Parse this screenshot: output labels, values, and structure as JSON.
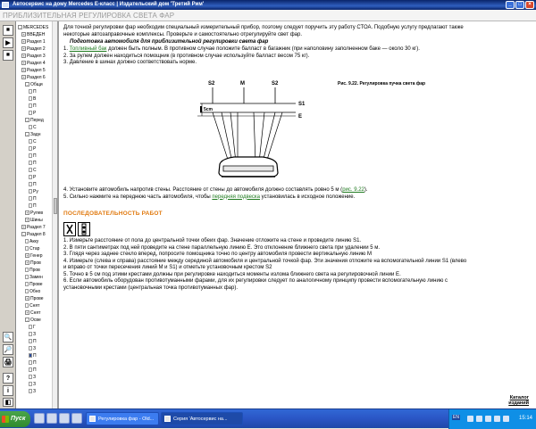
{
  "window": {
    "title": "Автосервис на дому Mercedes E-класс | Издательский дом 'Третий Рим'"
  },
  "page": {
    "header": "ПРИБЛИЗИТЕЛЬНАЯ РЕГУЛИРОВКА СВЕТА ФАР"
  },
  "toolbar": {
    "buttons": [
      "⏹",
      "▶",
      "⏹",
      "🔍",
      "🔎",
      "🖨",
      "?",
      "i",
      "◧"
    ]
  },
  "tree": {
    "items": [
      {
        "label": "MERCEDES",
        "box": "-",
        "indent": 0
      },
      {
        "label": "ВВЕДЕН",
        "box": "+",
        "indent": 1
      },
      {
        "label": "Раздел 1",
        "box": "+",
        "indent": 1
      },
      {
        "label": "Раздел 2",
        "box": "+",
        "indent": 1
      },
      {
        "label": "Раздел 3",
        "box": "+",
        "indent": 1
      },
      {
        "label": "Раздел 4",
        "box": "+",
        "indent": 1
      },
      {
        "label": "Раздел 5",
        "box": "+",
        "indent": 1
      },
      {
        "label": "Раздел 6",
        "box": "+",
        "indent": 1
      },
      {
        "label": "Общи",
        "box": "-",
        "indent": 2
      },
      {
        "label": "П",
        "page": true,
        "indent": 3
      },
      {
        "label": "В",
        "page": true,
        "indent": 3
      },
      {
        "label": "П",
        "page": true,
        "indent": 3
      },
      {
        "label": "Р",
        "page": true,
        "indent": 3
      },
      {
        "label": "Перед",
        "box": "-",
        "indent": 2
      },
      {
        "label": "С",
        "page": true,
        "indent": 3
      },
      {
        "label": "Задн",
        "box": "-",
        "indent": 2
      },
      {
        "label": "С",
        "page": true,
        "indent": 3
      },
      {
        "label": "Р",
        "page": true,
        "indent": 3
      },
      {
        "label": "П",
        "page": true,
        "indent": 3
      },
      {
        "label": "П",
        "page": true,
        "indent": 3
      },
      {
        "label": "С",
        "page": true,
        "indent": 3
      },
      {
        "label": "Р",
        "page": true,
        "indent": 3
      },
      {
        "label": "П",
        "page": true,
        "indent": 3
      },
      {
        "label": "Ру",
        "page": true,
        "indent": 3
      },
      {
        "label": "П",
        "page": true,
        "indent": 3
      },
      {
        "label": "П",
        "page": true,
        "indent": 3
      },
      {
        "label": "Рулев",
        "box": "+",
        "indent": 2
      },
      {
        "label": "Шины",
        "box": "+",
        "indent": 2
      },
      {
        "label": "Раздел 7",
        "box": "+",
        "indent": 1
      },
      {
        "label": "Раздел 8",
        "box": "-",
        "indent": 1
      },
      {
        "label": "Акку",
        "page": true,
        "indent": 2
      },
      {
        "label": "Стар",
        "page": true,
        "indent": 2
      },
      {
        "label": "Генер",
        "box": "+",
        "indent": 2
      },
      {
        "label": "Пров",
        "box": "+",
        "indent": 2
      },
      {
        "label": "Пров",
        "page": true,
        "indent": 2
      },
      {
        "label": "Замен",
        "page": true,
        "indent": 2
      },
      {
        "label": "Прове",
        "page": true,
        "indent": 2
      },
      {
        "label": "Обно",
        "page": true,
        "indent": 2
      },
      {
        "label": "Прове",
        "box": "+",
        "indent": 2
      },
      {
        "label": "Снят",
        "page": true,
        "indent": 2
      },
      {
        "label": "Снят",
        "box": "+",
        "indent": 2
      },
      {
        "label": "Осве",
        "box": "-",
        "indent": 2
      },
      {
        "label": "Г",
        "page": true,
        "indent": 3
      },
      {
        "label": "З",
        "page": true,
        "indent": 3
      },
      {
        "label": "П",
        "page": true,
        "indent": 3
      },
      {
        "label": "З",
        "page": true,
        "indent": 3
      },
      {
        "label": "П",
        "page": true,
        "indent": 3,
        "active": true
      },
      {
        "label": "П",
        "page": true,
        "indent": 3
      },
      {
        "label": "П",
        "page": true,
        "indent": 3
      },
      {
        "label": "З",
        "page": true,
        "indent": 3
      },
      {
        "label": "З",
        "page": true,
        "indent": 3
      },
      {
        "label": "З",
        "page": true,
        "indent": 3
      }
    ]
  },
  "content": {
    "intro": [
      "Для точной регулировки фар необходим специальный измерительный прибор, поэтому следует поручить эту работу СТОА. Подобную услугу предлагают также",
      "некоторые автозаправочные комплексы. Проверьте и самостоятельно отрегулируйте свет фар."
    ],
    "prep_title": "Подготовка автомобиля для приблизительной регулировки света фар",
    "prep_steps": [
      {
        "num": "1.",
        "link": "Топливный бак",
        "text": " должен быть полным. В противном случае положите балласт в багажник (при наполовину заполненном баке — около 30 кг)."
      },
      {
        "num": "2.",
        "link": "",
        "text": "За рулем должен находиться помощник (в противном случае используйте балласт весом 75 кг)."
      },
      {
        "num": "3.",
        "link": "",
        "text": "Давление в шинах должно соответствовать норме."
      }
    ],
    "figure": {
      "caption": "Рис. 9.22. Регулировка пучка света фар",
      "labels": {
        "s2_left": "S2",
        "m": "M",
        "s2_right": "S2",
        "s1": "S1",
        "e": "E",
        "dist": "5cm"
      }
    },
    "after_steps": [
      {
        "num": "4.",
        "pre": "Установите автомобиль напротив стены. Расстояние от стены до автомобиля должно составлять ровно 5 м (",
        "link": "рис. 9.22",
        "post": ")."
      },
      {
        "num": "5.",
        "pre": "Сильно нажмите на переднюю часть автомобиля, чтобы ",
        "link": "передняя подвеска",
        "post": " установилась в исходное положение."
      }
    ],
    "sequence_title": "ПОСЛЕДОВАТЕЛЬНОСТЬ РАБОТ",
    "sequence_steps": [
      "1. Измерьте расстояние от пола до центральной точки обеих фар. Значение отложите на стене и проведите линию S1.",
      "2. В пяти сантиметрах под ней проведите на стене параллельную линию E. Это отклонение ближнего света при удалении 5 м.",
      "3. Глядя через заднее стекло вперед, попросите помощника точно по центру автомобиля провести вертикальную линию M",
      "4. Измерьте (слева и справа) расстояние между серединой автомобиля и центральной точкой фар. Эти значения отложите на вспомогательной линии S1 (влево",
      "и вправо от точки пересечения линий M и S1) и отметьте установочным крестом S2",
      "5. Точно в 5 см под этими крестами должны при регулировке находиться моменты излома ближнего света на регулировочной линии E.",
      "6. Если автомобиль оборудован противотуманными фарами, для их регулировки следует по аналогичному принципу провести вспомогательную линию с",
      "установочными крестами (центральная точка противотуманных фар)."
    ],
    "contents_link": "Каталог изданий"
  },
  "taskbar": {
    "start": "Пуск",
    "tasks": [
      {
        "label": "Регулировка фар - Old...",
        "active": false
      },
      {
        "label": "Серия 'Автосервис на...",
        "active": true
      }
    ],
    "lang": "EN",
    "clock": "15:14"
  }
}
